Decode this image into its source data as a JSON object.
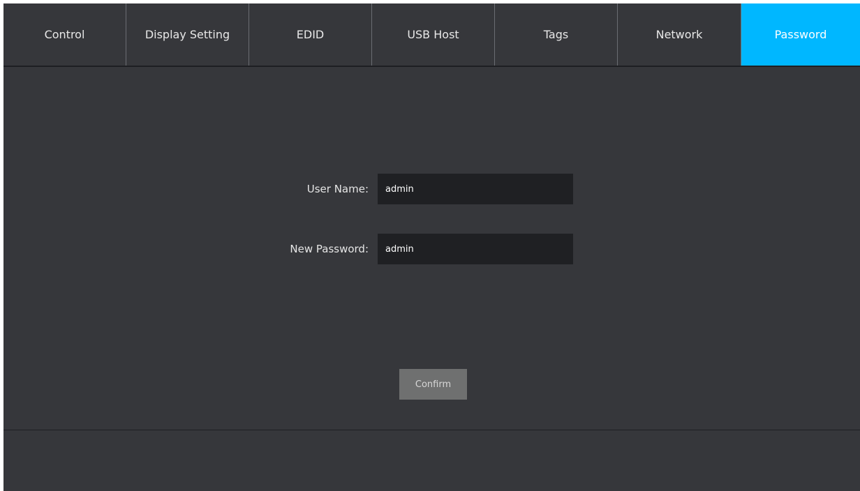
{
  "tabs": [
    {
      "label": "Control",
      "active": false
    },
    {
      "label": "Display Setting",
      "active": false
    },
    {
      "label": "EDID",
      "active": false
    },
    {
      "label": "USB Host",
      "active": false
    },
    {
      "label": "Tags",
      "active": false
    },
    {
      "label": "Network",
      "active": false
    },
    {
      "label": "Password",
      "active": true
    }
  ],
  "form": {
    "username_label": "User Name:",
    "username_value": "admin",
    "password_label": "New Password:",
    "password_value": "admin",
    "confirm_label": "Confirm"
  },
  "colors": {
    "background": "#36373b",
    "active_tab": "#00b7ff",
    "input_bg": "#1f2023",
    "button_bg": "#6f7070"
  }
}
